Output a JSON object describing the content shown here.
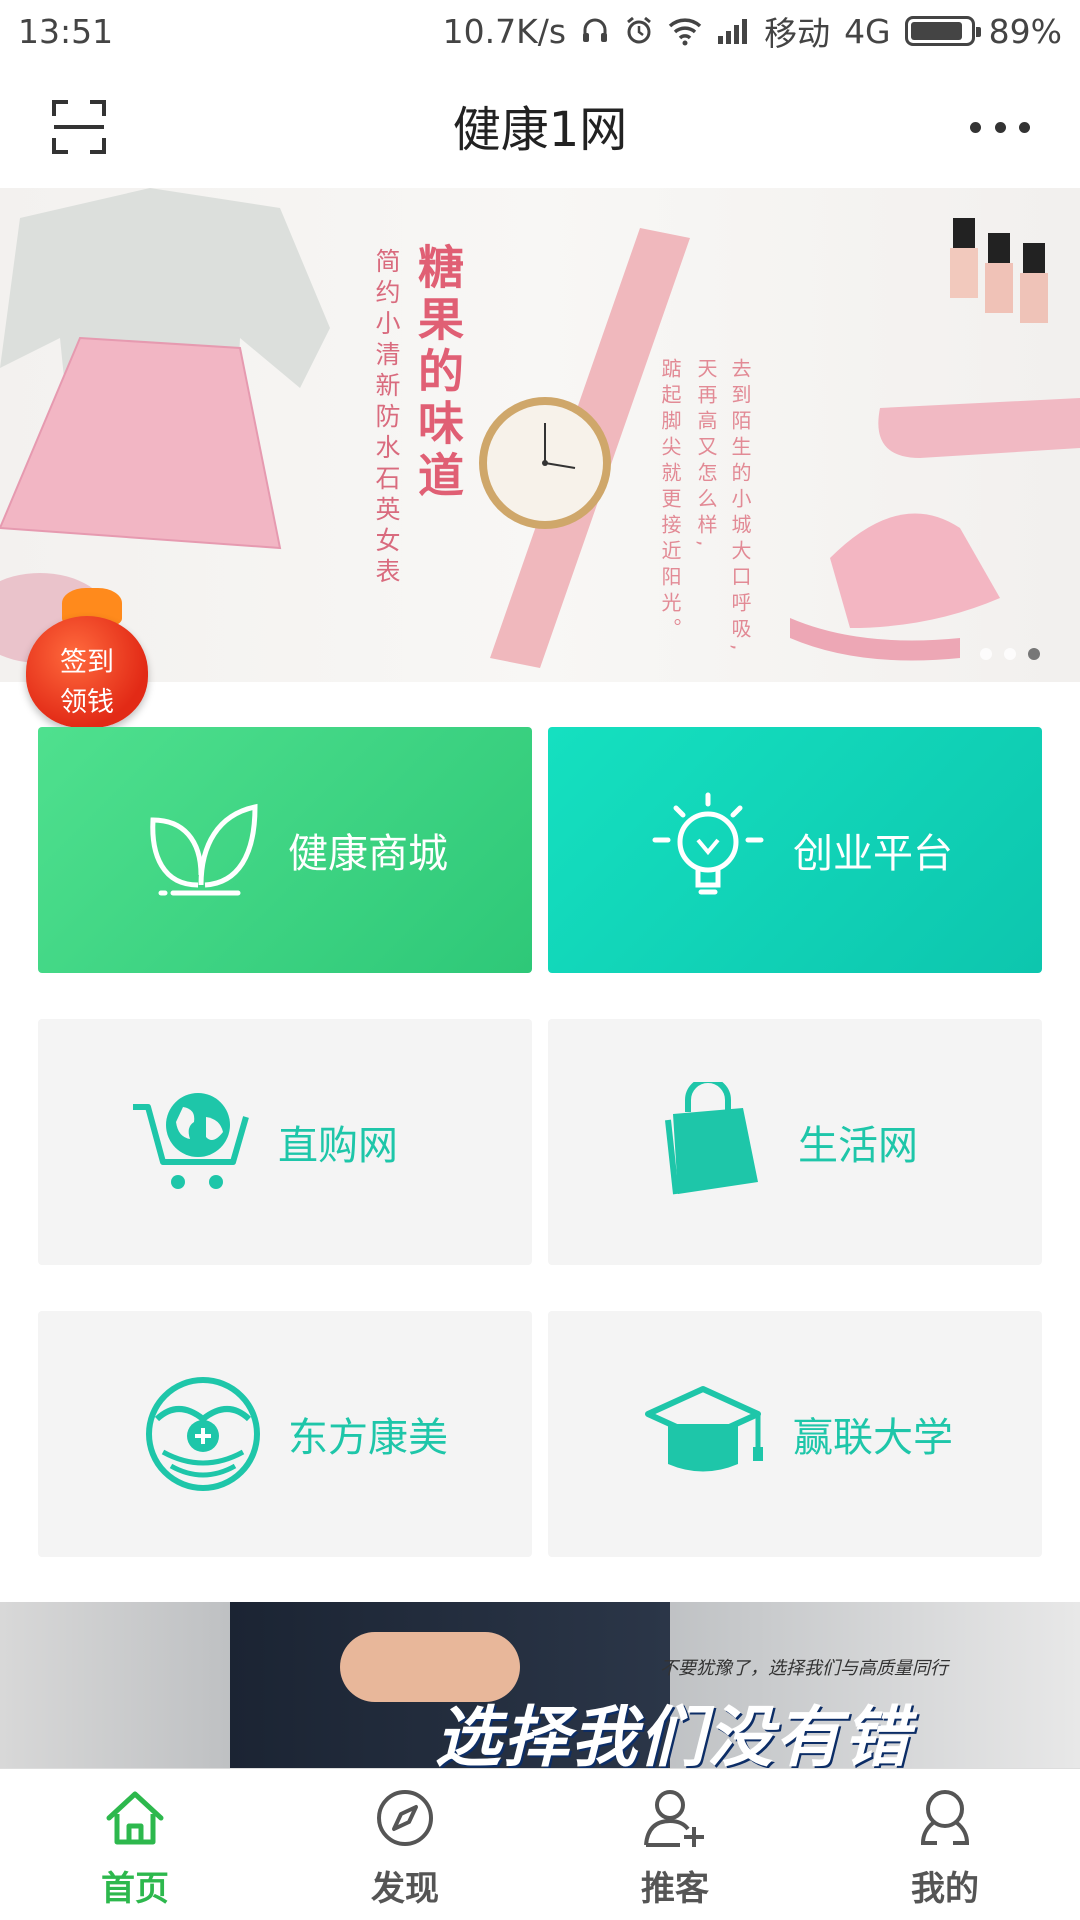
{
  "status_bar": {
    "time": "13:51",
    "speed": "10.7K/s",
    "carrier": "移动",
    "network": "4G",
    "battery": "89%",
    "battery_level": 0.89
  },
  "header": {
    "title": "健康1网",
    "scan_icon": "scan-icon",
    "more_icon": "more-icon"
  },
  "banner": {
    "title": "糖果的味道",
    "subtitle": "简约小清新防水石英女表",
    "poem_lines": [
      "去到陌生的小城大口呼吸,",
      "天再高又怎么样,",
      "踮起脚尖就更接近阳光。"
    ],
    "slide_count": 3,
    "active_slide": 3
  },
  "sign_badge": {
    "line1": "签到",
    "line2": "领钱"
  },
  "tiles": [
    {
      "label": "健康商城",
      "icon": "sprout-icon",
      "style": "green"
    },
    {
      "label": "创业平台",
      "icon": "lightbulb-icon",
      "style": "teal"
    },
    {
      "label": "直购网",
      "icon": "globe-cart-icon",
      "style": "grey"
    },
    {
      "label": "生活网",
      "icon": "shopping-bag-icon",
      "style": "grey"
    },
    {
      "label": "东方康美",
      "icon": "kangmei-logo-icon",
      "style": "grey"
    },
    {
      "label": "赢联大学",
      "icon": "graduation-cap-icon",
      "style": "grey"
    }
  ],
  "ad": {
    "subtitle": "不要犹豫了，选择我们与高质量同行",
    "title": "选择我们没有错"
  },
  "tab_bar": [
    {
      "label": "首页",
      "icon": "home-icon",
      "active": true
    },
    {
      "label": "发现",
      "icon": "compass-icon",
      "active": false
    },
    {
      "label": "推客",
      "icon": "add-user-icon",
      "active": false
    },
    {
      "label": "我的",
      "icon": "profile-icon",
      "active": false
    }
  ],
  "colors": {
    "accent_green": "#2db84d",
    "tile_green": "#3ed382",
    "tile_teal": "#12d6b8",
    "icon_teal": "#1ec6a9"
  }
}
